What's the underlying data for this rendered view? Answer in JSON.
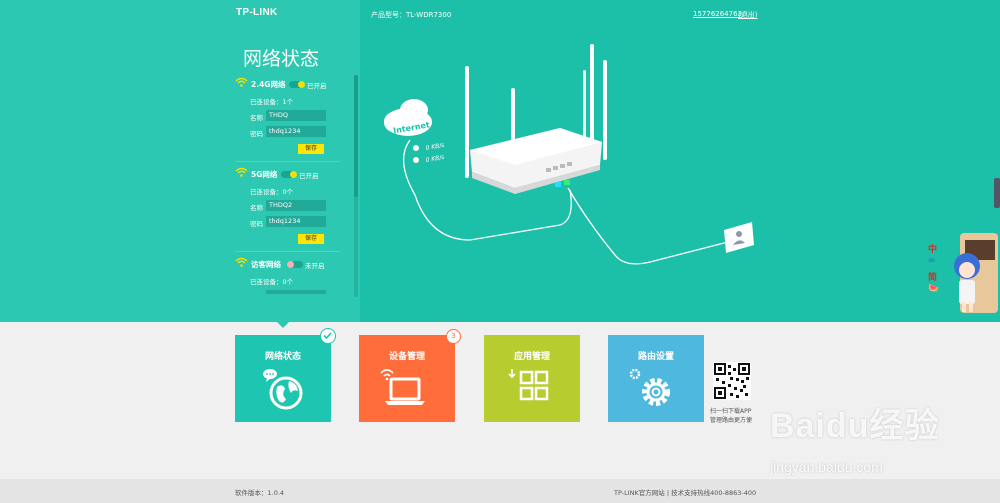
{
  "header": {
    "logo": "TP-LINK",
    "model": "产品型号：TL-WDR7300",
    "phone": "15776264763",
    "logout": "(退出)"
  },
  "panel": {
    "title": "网络状态",
    "sections": [
      {
        "name": "2.4G网络",
        "status": "已开启",
        "on": true,
        "devices": "已连设备：1个",
        "name_label": "名称",
        "ssid": "THDQ",
        "pwd_label": "密码",
        "password": "thdq1234",
        "save": "保存"
      },
      {
        "name": "5G网络",
        "status": "已开启",
        "on": true,
        "devices": "已连设备：0个",
        "name_label": "名称",
        "ssid": "THDQ2",
        "pwd_label": "密码",
        "password": "thdq1234",
        "save": "保存"
      },
      {
        "name": "访客网络",
        "status": "未开启",
        "on": false,
        "devices": "已连设备：0个"
      }
    ]
  },
  "diagram": {
    "cloud_label": "Internet",
    "up_speed": "0 KB/s",
    "down_speed": "0 KB/s"
  },
  "tiles": [
    {
      "label": "网络状态",
      "color": "#1ec5b0",
      "icon": "globe-icon"
    },
    {
      "label": "设备管理",
      "color": "#ff6d3a",
      "icon": "laptop-icon",
      "badge": "3"
    },
    {
      "label": "应用管理",
      "color": "#b7cc2e",
      "icon": "apps-icon"
    },
    {
      "label": "路由设置",
      "color": "#4fb8de",
      "icon": "gear-icon"
    }
  ],
  "qr": {
    "line1": "扫一扫下载APP",
    "line2": "管理路由更方便"
  },
  "footer": {
    "version": "软件版本：1.0.4",
    "links": "TP-LINK官方网站  |  技术支持热线400-8863-400"
  },
  "widget": {
    "chars": [
      "中",
      "∞",
      "简",
      "🍉"
    ]
  },
  "watermark": {
    "main": "Baidu经验",
    "sub": "jingyan.baidu.com"
  }
}
